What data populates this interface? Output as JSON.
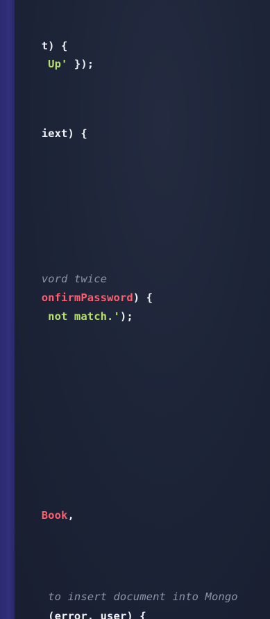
{
  "code_lines": [
    {
      "segments": [
        {
          "text": "t) {",
          "color": "white"
        }
      ]
    },
    {
      "segments": [
        {
          "text": " Up'",
          "color": "green"
        },
        {
          "text": " });",
          "color": "white"
        }
      ]
    },
    {
      "segments": [
        {
          "text": "iext) {",
          "color": "white"
        }
      ]
    },
    {
      "segments": [
        {
          "text": "vord twice",
          "color": "comment"
        }
      ]
    },
    {
      "segments": [
        {
          "text": "onfirmPassword",
          "color": "red"
        },
        {
          "text": ") {",
          "color": "white"
        }
      ]
    },
    {
      "segments": [
        {
          "text": " not match.'",
          "color": "green"
        },
        {
          "text": ");",
          "color": "white"
        }
      ]
    },
    {
      "segments": [
        {
          "text": "Book",
          "color": "red"
        },
        {
          "text": ",",
          "color": "white"
        }
      ]
    },
    {
      "segments": [
        {
          "text": " to insert document into Mongo",
          "color": "comment"
        }
      ]
    },
    {
      "segments": [
        {
          "text": " (error, user) {",
          "color": "white"
        }
      ]
    }
  ],
  "colors": {
    "background": "#1c2336",
    "bezel": "#322f7c",
    "white": "#eef0f5",
    "green": "#b6e06a",
    "red": "#ff5f6d",
    "comment": "#8d93a8"
  }
}
